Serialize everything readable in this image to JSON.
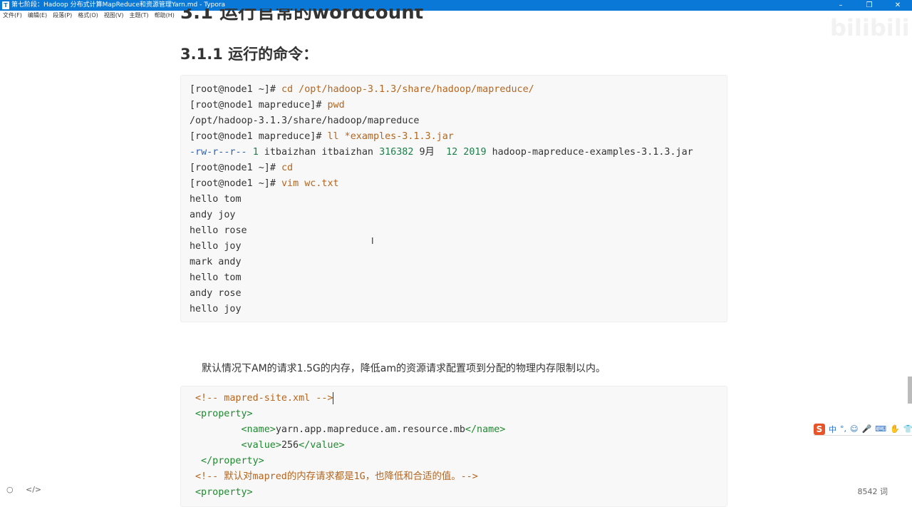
{
  "window": {
    "title": "第七阶段：Hadoop 分布式计算MapReduce和资源管理Yarn.md - Typora",
    "app_icon": "T",
    "minimize": "–",
    "restore": "❐",
    "close": "✕"
  },
  "menu": [
    "文件(F)",
    "编辑(E)",
    "段落(P)",
    "格式(O)",
    "视图(V)",
    "主题(T)",
    "帮助(H)"
  ],
  "doc": {
    "h2": "3.1 运行官常的wordcount",
    "h3": "3.1.1 运行的命令：",
    "code1": [
      [
        [
          "[root@node1 ~]# ",
          "#333"
        ],
        [
          "cd /opt/hadoop-3.1.3/share/hadoop/mapreduce/",
          "#b5651d"
        ]
      ],
      [
        [
          "[root@node1 mapreduce]# ",
          "#333"
        ],
        [
          "pwd",
          "#b5651d"
        ]
      ],
      [
        [
          "/opt/hadoop-3.1.3/share/hadoop/mapreduce",
          "#333"
        ]
      ],
      [
        [
          "[root@node1 mapreduce]# ",
          "#333"
        ],
        [
          "ll *examples-3.1.3.jar",
          "#b5651d"
        ]
      ],
      [
        [
          "-rw-r--r--",
          "#2a62b8"
        ],
        [
          " ",
          "#333"
        ],
        [
          "1",
          "#1e7d4a"
        ],
        [
          " itbaizhan itbaizhan ",
          "#333"
        ],
        [
          "316382",
          "#1e7d4a"
        ],
        [
          " 9月  ",
          "#333"
        ],
        [
          "12 2019",
          "#1e7d4a"
        ],
        [
          " hadoop-mapreduce-examples-3.1.3.jar",
          "#333"
        ]
      ],
      [
        [
          "[root@node1 ~]# ",
          "#333"
        ],
        [
          "cd",
          "#b5651d"
        ]
      ],
      [
        [
          "[root@node1 ~]# ",
          "#333"
        ],
        [
          "vim wc.txt",
          "#b5651d"
        ]
      ],
      [
        [
          "hello tom",
          "#333"
        ]
      ],
      [
        [
          "andy joy",
          "#333"
        ]
      ],
      [
        [
          "hello rose",
          "#333"
        ]
      ],
      [
        [
          "hello joy",
          "#333"
        ]
      ],
      [
        [
          "mark andy",
          "#333"
        ]
      ],
      [
        [
          "hello tom",
          "#333"
        ]
      ],
      [
        [
          "andy rose",
          "#333"
        ]
      ],
      [
        [
          "hello joy",
          "#333"
        ]
      ]
    ],
    "paragraph": "默认情况下AM的请求1.5G的内存，降低am的资源请求配置项到分配的物理内存限制以内。",
    "code2": [
      [
        [
          "<!-- mapred-site.xml -->",
          "#b5651d"
        ]
      ],
      [
        [
          "<property>",
          "#1d8a2e"
        ]
      ],
      [
        [
          "        ",
          "#333"
        ],
        [
          "<name>",
          "#1d8a2e"
        ],
        [
          "yarn.app.mapreduce.am.resource.mb",
          "#333"
        ],
        [
          "</name>",
          "#1d8a2e"
        ]
      ],
      [
        [
          "        ",
          "#333"
        ],
        [
          "<value>",
          "#1d8a2e"
        ],
        [
          "256",
          "#333"
        ],
        [
          "</value>",
          "#1d8a2e"
        ]
      ],
      [
        [
          " </property>",
          "#1d8a2e"
        ]
      ],
      [
        [
          "<!-- 默认对mapred的内存请求都是1G，也降低和合适的值。-->",
          "#b5651d"
        ]
      ],
      [
        [
          "<property>",
          "#1d8a2e"
        ]
      ]
    ]
  },
  "ime": {
    "logo": "S",
    "items": [
      "中",
      "°,",
      "☺",
      "🎤",
      "⌨",
      "✋",
      "👕",
      "▦"
    ]
  },
  "status": {
    "word_count": "8542 词",
    "left_icon": "○",
    "source_icon": "</>"
  }
}
